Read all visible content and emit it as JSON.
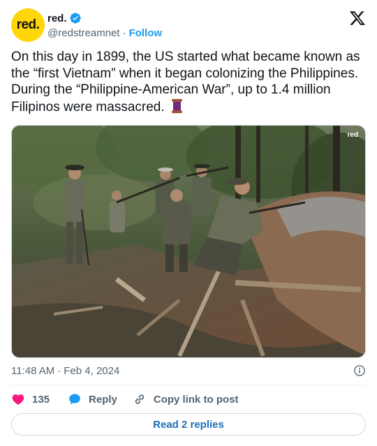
{
  "author": {
    "avatar_text": "red.",
    "display_name": "red.",
    "handle": "@redstreamnet",
    "separator": "·",
    "follow_label": "Follow"
  },
  "tweet": {
    "text": "On this day in 1899, the US started what became known as the “first Vietnam” when it began colonizing the Philippines. During the “Philippine-American War”, up to 1.4 million Filipinos were massacred.",
    "emoji": "spool-of-thread",
    "media_watermark": "red"
  },
  "meta": {
    "time": "11:48 AM",
    "separator": "·",
    "date": "Feb 4, 2024"
  },
  "actions": {
    "like_count": "135",
    "reply_label": "Reply",
    "copy_label": "Copy link to post",
    "read_replies_label": "Read 2 replies"
  },
  "icons": {
    "verified": "verified-badge-icon",
    "platform": "x-logo-icon",
    "info": "info-icon",
    "like": "heart-icon",
    "reply": "speech-bubble-icon",
    "copy": "link-icon"
  },
  "colors": {
    "accent": "#1d9bf0",
    "like": "#f91880",
    "avatar_bg": "#ffd60a"
  }
}
